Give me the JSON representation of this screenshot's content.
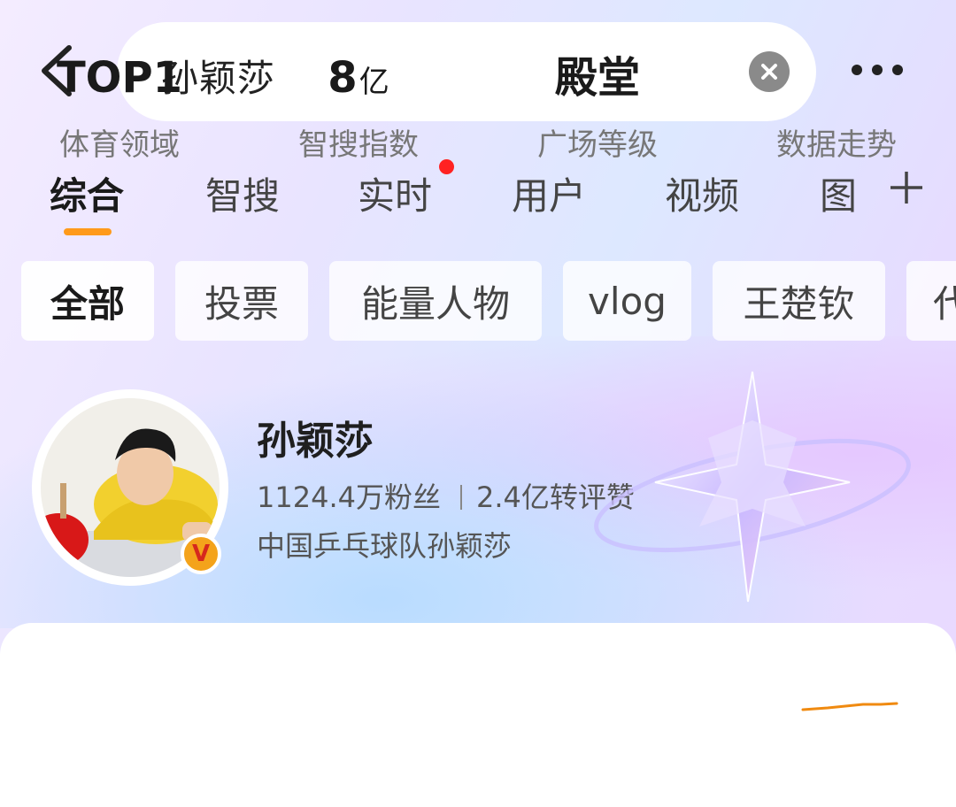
{
  "search": {
    "query": "孙颖莎"
  },
  "tabs": [
    {
      "label": "综合",
      "active": true
    },
    {
      "label": "智搜"
    },
    {
      "label": "实时",
      "has_dot": true
    },
    {
      "label": "用户"
    },
    {
      "label": "视频"
    },
    {
      "label": "图"
    }
  ],
  "chips": [
    {
      "label": "全部",
      "active": true
    },
    {
      "label": "投票"
    },
    {
      "label": "能量人物"
    },
    {
      "label": "vlog"
    },
    {
      "label": "王楚钦"
    },
    {
      "label": "代"
    }
  ],
  "profile": {
    "name": "孙颖莎",
    "followers": "1124.4万粉丝",
    "interactions": "2.4亿转评赞",
    "description": "中国乒乓球队孙颖莎",
    "badge": "V"
  },
  "metrics": [
    {
      "value": "TOP1",
      "unit": "",
      "label": "体育领域"
    },
    {
      "value": "8",
      "unit": "亿",
      "label": "智搜指数"
    },
    {
      "value": "殿堂",
      "unit": "",
      "label": "广场等级"
    },
    {
      "value": "",
      "unit": "",
      "label": "数据走势"
    }
  ],
  "colors": {
    "accent": "#ff9a1a",
    "dot": "#ff2222",
    "trend": "#f08a10"
  },
  "icons": {
    "back": "chevron-left-icon",
    "clear": "close-icon",
    "more": "more-dots-icon",
    "plus": "plus-icon",
    "verified": "verified-badge-icon"
  }
}
